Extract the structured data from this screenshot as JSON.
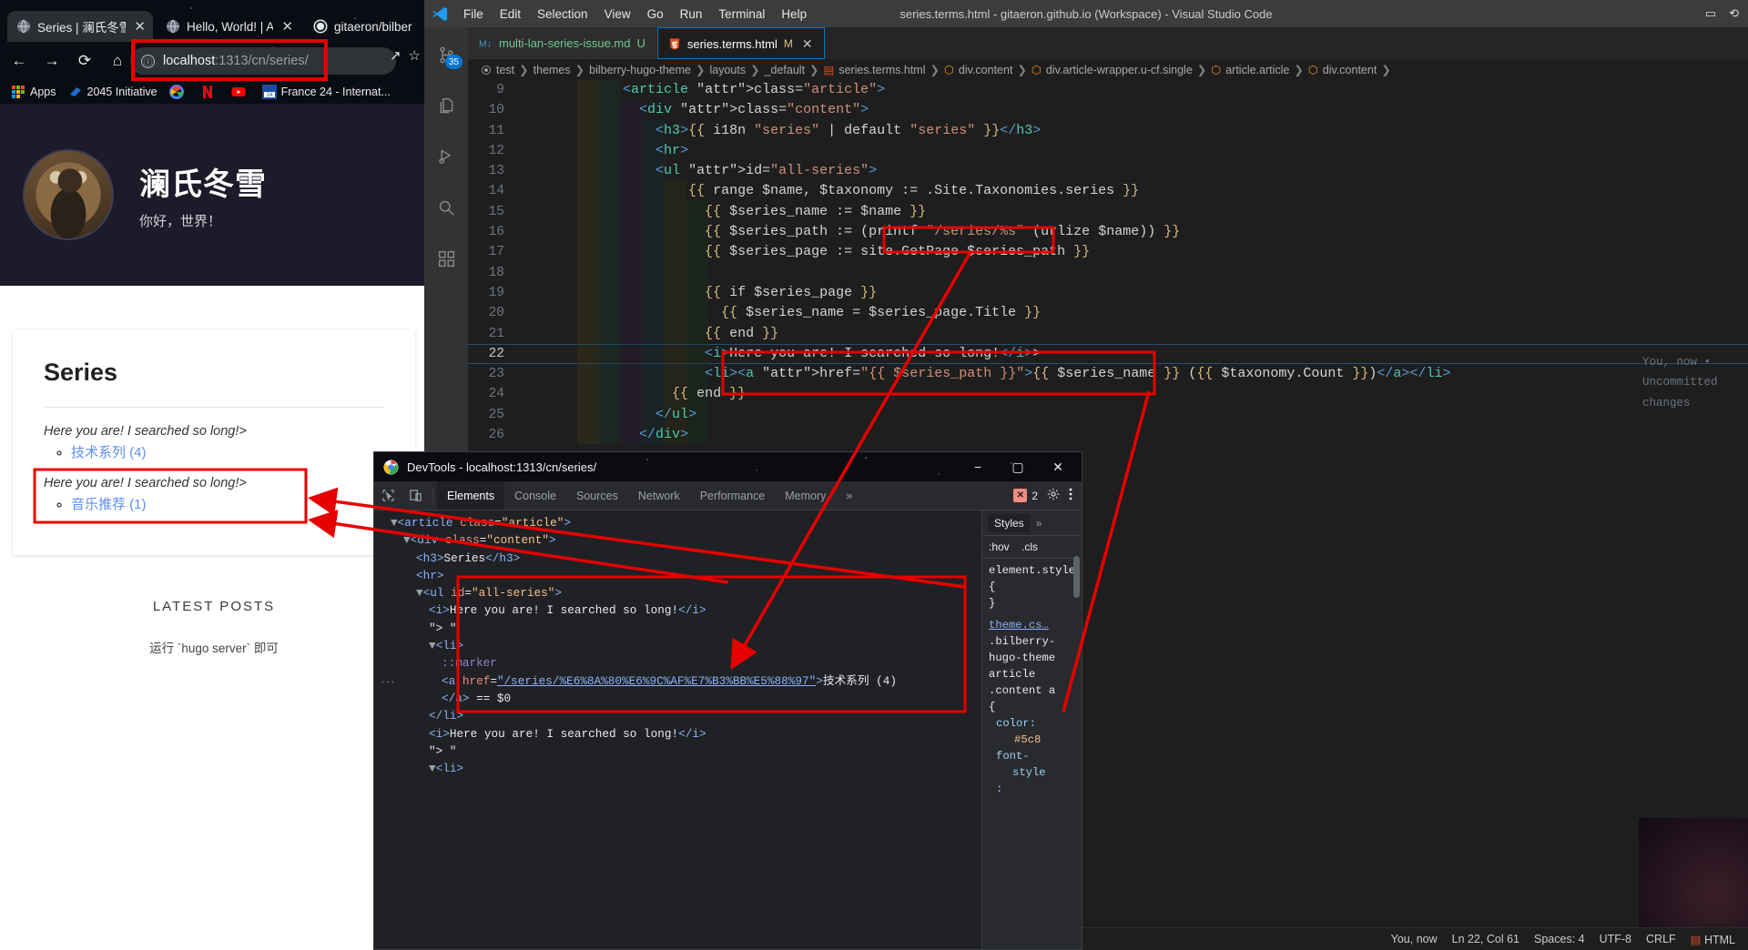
{
  "browser": {
    "tabs": [
      {
        "label": "Series | 澜氏冬雪",
        "active": true
      },
      {
        "label": "Hello, World! | Aer",
        "active": false
      },
      {
        "label": "gitaeron/bilber",
        "active": false
      }
    ],
    "close_glyph": "✕",
    "nav": {
      "back": "←",
      "forward": "→",
      "reload": "⟳",
      "home": "⌂"
    },
    "omnibox": {
      "info_glyph": "ⓘ",
      "host": "localhost",
      "rest": ":1313/cn/series/"
    },
    "omni_right": {
      "share": "↗",
      "star": "☆"
    },
    "bookmarks": [
      {
        "label": "Apps",
        "icon": "apps-grid-icon"
      },
      {
        "label": "2045 Initiative",
        "icon": "blue-bird-icon"
      },
      {
        "label": "",
        "icon": "google-icon"
      },
      {
        "label": "",
        "icon": "netflix-icon"
      },
      {
        "label": "",
        "icon": "youtube-icon"
      },
      {
        "label": "France 24 - Internat...",
        "icon": "france24-icon"
      }
    ],
    "page": {
      "site_title": "澜氏冬雪",
      "site_subtitle": "你好，世界！",
      "heading": "Series",
      "series": [
        {
          "note": "Here you are! I searched so long!>",
          "link": "技术系列 (4)"
        },
        {
          "note": "Here you are! I searched so long!>",
          "link": "音乐推荐 (1)"
        }
      ],
      "latest_heading": "LATEST POSTS",
      "latest_sub": "运行 `hugo server` 即可"
    }
  },
  "vscode": {
    "menu": [
      "File",
      "Edit",
      "Selection",
      "View",
      "Go",
      "Run",
      "Terminal",
      "Help"
    ],
    "title": "series.terms.html - gitaeron.github.io (Workspace) - Visual Studio Code",
    "title_right": [
      "▭",
      "⟲"
    ],
    "activity_badge": "35",
    "activity_items": [
      {
        "name": "source-control-icon",
        "glyph": "⑂",
        "active": false,
        "badge": "35"
      },
      {
        "name": "explorer-icon",
        "glyph": "🗎",
        "active": false,
        "badge": ""
      },
      {
        "name": "run-debug-icon",
        "glyph": "▷",
        "active": false,
        "badge": ""
      },
      {
        "name": "search-icon",
        "glyph": "🔍",
        "active": false,
        "badge": ""
      },
      {
        "name": "extensions-icon",
        "glyph": "▦",
        "active": false,
        "badge": ""
      }
    ],
    "tabs": [
      {
        "label": "multi-lan-series-issue.md",
        "badge": "U",
        "badge_kind": "untracked",
        "icon": "markdown-icon",
        "active": false
      },
      {
        "label": "series.terms.html",
        "badge": "M",
        "badge_kind": "modified",
        "icon": "html5-icon",
        "active": true
      }
    ],
    "breadcrumb": [
      "test",
      "themes",
      "bilberry-hugo-theme",
      "layouts",
      "_default",
      "series.terms.html",
      "div.content",
      "div.article-wrapper.u-cf.single",
      "article.article",
      "div.content"
    ],
    "codelens": "You, now • Uncommitted changes",
    "code": [
      {
        "n": "9",
        "text": "            <article class=\"article\">"
      },
      {
        "n": "10",
        "text": "              <div class=\"content\">"
      },
      {
        "n": "11",
        "text": "                <h3>{{ i18n \"series\" | default \"series\" }}</h3>"
      },
      {
        "n": "12",
        "text": "                <hr>"
      },
      {
        "n": "13",
        "text": "                <ul id=\"all-series\">"
      },
      {
        "n": "14",
        "text": "                    {{ range $name, $taxonomy := .Site.Taxonomies.series }}"
      },
      {
        "n": "15",
        "text": "                      {{ $series_name := $name }}"
      },
      {
        "n": "16",
        "text": "                      {{ $series_path := (printf \"/series/%s\" (urlize $name)) }}"
      },
      {
        "n": "17",
        "text": "                      {{ $series_page := site.GetPage $series_path }}"
      },
      {
        "n": "18",
        "text": ""
      },
      {
        "n": "19",
        "text": "                      {{ if $series_page }}"
      },
      {
        "n": "20",
        "text": "                        {{ $series_name = $series_page.Title }}"
      },
      {
        "n": "21",
        "text": "                      {{ end }}"
      },
      {
        "n": "22",
        "text": "                      <i>Here you are! I searched so long!</i>>"
      },
      {
        "n": "23",
        "text": "                      <li><a href=\"{{ $series_path }}\">{{ $series_name }} ({{ $taxonomy.Count }})</a></li>"
      },
      {
        "n": "24",
        "text": "                  {{ end }}"
      },
      {
        "n": "25",
        "text": "                </ul>"
      },
      {
        "n": "26",
        "text": "              </div>"
      }
    ],
    "status": {
      "git": "You, now",
      "cursor": "Ln 22, Col 61",
      "spaces": "Spaces: 4",
      "encoding": "UTF-8",
      "eol": "CRLF",
      "language": "HTML",
      "lang_icon": "html5-icon"
    }
  },
  "devtools": {
    "window_title": "DevTools - localhost:1313/cn/series/",
    "window_buttons": [
      "−",
      "▢",
      "✕"
    ],
    "toolbar_icons": [
      "inspect-element-icon",
      "device-toolbar-icon"
    ],
    "tabs": [
      "Elements",
      "Console",
      "Sources",
      "Network",
      "Performance",
      "Memory"
    ],
    "overflow_glyph": "»",
    "active_tab": "Elements",
    "error_count": "2",
    "right_icons": [
      "settings-gear-icon",
      "kebab-menu-icon"
    ],
    "dom": [
      {
        "indent": 1,
        "arrow": "▼",
        "html": "<span class='d-arrow'></span><span class='d-tag'>&lt;article</span> <span class='d-attr'>class</span>=<span class='d-val'>\"article\"</span><span class='d-tag'>&gt;</span>"
      },
      {
        "indent": 2,
        "arrow": "▼",
        "html": "<span class='d-tag'>&lt;div</span> <span class='d-attr'>class</span>=<span class='d-val'>\"content\"</span><span class='d-tag'>&gt;</span>"
      },
      {
        "indent": 3,
        "arrow": "",
        "html": "<span class='d-tag'>&lt;h3&gt;</span><span class='d-txt'>Series</span><span class='d-tag'>&lt;/h3&gt;</span>"
      },
      {
        "indent": 3,
        "arrow": "",
        "html": "<span class='d-tag'>&lt;hr&gt;</span>"
      },
      {
        "indent": 3,
        "arrow": "▼",
        "html": "<span class='d-tag'>&lt;ul</span> <span class='d-attr'>id</span>=<span class='d-val'>\"all-series\"</span><span class='d-tag'>&gt;</span>"
      },
      {
        "indent": 4,
        "arrow": "",
        "html": "<span class='d-tag'>&lt;i&gt;</span><span class='d-txt'>Here you are! I searched so long!</span><span class='d-tag'>&lt;/i&gt;</span>"
      },
      {
        "indent": 4,
        "arrow": "",
        "html": "<span class='d-txt'>\"&gt; \"</span>"
      },
      {
        "indent": 4,
        "arrow": "▼",
        "html": "<span class='d-tag'>&lt;li&gt;</span>"
      },
      {
        "indent": 5,
        "arrow": "",
        "html": "<span class='d-pseudo'>::marker</span>"
      },
      {
        "indent": 5,
        "arrow": "",
        "html": "<span class='d-tag'>&lt;a</span> <span class='d-attr'>href</span>=<span class='d-link'>\"/series/%E6%8A%80%E6%9C%AF%E7%B3%BB%E5%88%97\"</span><span class='d-tag'>&gt;</span><span class='d-txt'>技术系列 (4)</span>"
      },
      {
        "indent": 5,
        "arrow": "",
        "html": "<span class='d-tag'>&lt;/a&gt;</span> <span class='d-txt'>== $0</span>"
      },
      {
        "indent": 4,
        "arrow": "",
        "html": "<span class='d-tag'>&lt;/li&gt;</span>"
      },
      {
        "indent": 4,
        "arrow": "",
        "html": "<span class='d-tag'>&lt;i&gt;</span><span class='d-txt'>Here you are! I searched so long!</span><span class='d-tag'>&lt;/i&gt;</span>"
      },
      {
        "indent": 4,
        "arrow": "",
        "html": "<span class='d-txt'>\"&gt; \"</span>"
      },
      {
        "indent": 4,
        "arrow": "▼",
        "html": "<span class='d-tag'>&lt;li&gt;</span>"
      }
    ],
    "ellipsis": "...",
    "styles": {
      "tab": "Styles",
      "more": "»",
      "hov": ":hov",
      "cls": ".cls",
      "element_style": "element.style {",
      "element_style_close": "}",
      "source_file": "theme.cs…",
      "selector_l1": ".bilberry-",
      "selector_l2": "hugo-theme",
      "selector_l3": "article",
      "selector_l4": ".content a",
      "selector_l5": "{",
      "prop_color": "color:",
      "val_color": "#5c8",
      "prop_fontstyle": "font-",
      "prop_fontstyle2": "style",
      "prop_fontstyle3": ":"
    }
  },
  "annotations": {
    "color": "#e60000",
    "boxes": [
      {
        "name": "omnibox-highlight"
      },
      {
        "name": "printf-highlight"
      },
      {
        "name": "code-line-22-23-highlight"
      },
      {
        "name": "rendered-series-highlight"
      },
      {
        "name": "devtools-ul-highlight"
      }
    ]
  }
}
